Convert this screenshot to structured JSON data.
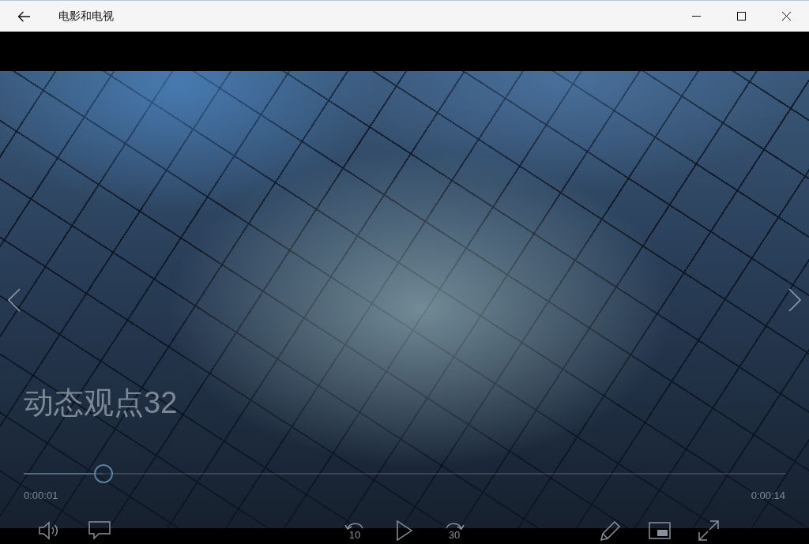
{
  "window": {
    "title": "电影和电视"
  },
  "player": {
    "video_title": "动态观点32",
    "progress": {
      "level": 0.105
    },
    "elapsed": "0:00:01",
    "duration": "0:00:14"
  },
  "controls": {
    "left": [
      {
        "kind": "volume"
      },
      {
        "kind": "subtitles"
      }
    ],
    "center": [
      {
        "kind": "rewind",
        "label": "10"
      },
      {
        "kind": "play"
      },
      {
        "kind": "forward",
        "label": "30"
      }
    ],
    "right": [
      {
        "kind": "edit"
      },
      {
        "kind": "mini_view"
      },
      {
        "kind": "fullscreen"
      }
    ]
  }
}
